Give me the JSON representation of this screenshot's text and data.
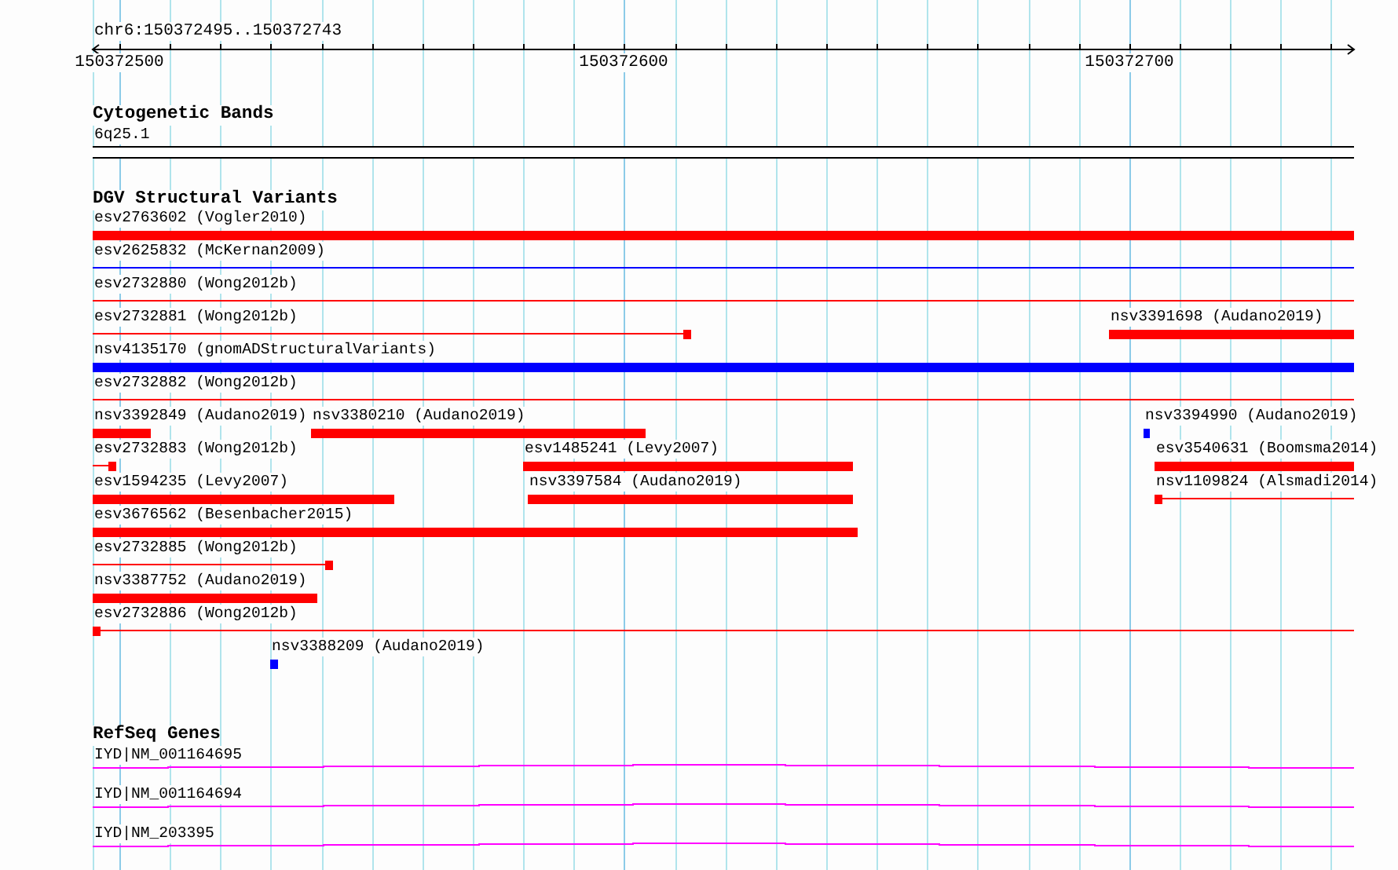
{
  "ruler": {
    "location": "chr6:150372495..150372743",
    "ticks": [
      "150372500",
      "150372600",
      "150372700"
    ]
  },
  "tracks": [
    {
      "title": "Cytogenetic Bands",
      "kind": "bands",
      "features": [
        {
          "label": "6q25.1"
        }
      ]
    },
    {
      "title": "DGV Structural Variants",
      "kind": "variants",
      "features": [
        {
          "label": "esv2763602 (Vogler2010)",
          "kind": "bar",
          "color": "#ff0000"
        },
        {
          "label": "esv2625832 (McKernan2009)",
          "kind": "line",
          "color": "#0000ff"
        },
        {
          "label": "esv2732880 (Wong2012b)",
          "kind": "line",
          "color": "#ff0000"
        },
        {
          "label": "esv2732881 (Wong2012b)",
          "kind": "line-box",
          "color": "#ff0000"
        },
        {
          "label": "nsv3391698 (Audano2019)",
          "kind": "bar",
          "color": "#ff0000"
        },
        {
          "label": "nsv4135170 (gnomADStructuralVariants)",
          "kind": "bar",
          "color": "#0000ff"
        },
        {
          "label": "esv2732882 (Wong2012b)",
          "kind": "line",
          "color": "#ff0000"
        },
        {
          "label": "nsv3392849 (Audano2019)",
          "kind": "bar",
          "color": "#ff0000"
        },
        {
          "label": "nsv3380210 (Audano2019)",
          "kind": "bar",
          "color": "#ff0000"
        },
        {
          "label": "nsv3394990 (Audano2019)",
          "kind": "box",
          "color": "#0000ff"
        },
        {
          "label": "esv2732883 (Wong2012b)",
          "kind": "line-box",
          "color": "#ff0000"
        },
        {
          "label": "esv1485241 (Levy2007)",
          "kind": "bar",
          "color": "#ff0000"
        },
        {
          "label": "esv3540631 (Boomsma2014)",
          "kind": "bar",
          "color": "#ff0000"
        },
        {
          "label": "esv1594235 (Levy2007)",
          "kind": "bar",
          "color": "#ff0000"
        },
        {
          "label": "nsv3397584 (Audano2019)",
          "kind": "bar",
          "color": "#ff0000"
        },
        {
          "label": "nsv1109824 (Alsmadi2014)",
          "kind": "box-line",
          "color": "#ff0000"
        },
        {
          "label": "esv3676562 (Besenbacher2015)",
          "kind": "bar",
          "color": "#ff0000"
        },
        {
          "label": "esv2732885 (Wong2012b)",
          "kind": "line-box",
          "color": "#ff0000"
        },
        {
          "label": "nsv3387752 (Audano2019)",
          "kind": "bar",
          "color": "#ff0000"
        },
        {
          "label": "esv2732886 (Wong2012b)",
          "kind": "box-line",
          "color": "#ff0000"
        },
        {
          "label": "nsv3388209 (Audano2019)",
          "kind": "box",
          "color": "#0000ff"
        }
      ]
    },
    {
      "title": "RefSeq Genes",
      "kind": "genes",
      "features": [
        {
          "label": "IYD|NM_001164695"
        },
        {
          "label": "IYD|NM_001164694"
        },
        {
          "label": "IYD|NM_203395"
        }
      ]
    }
  ]
}
